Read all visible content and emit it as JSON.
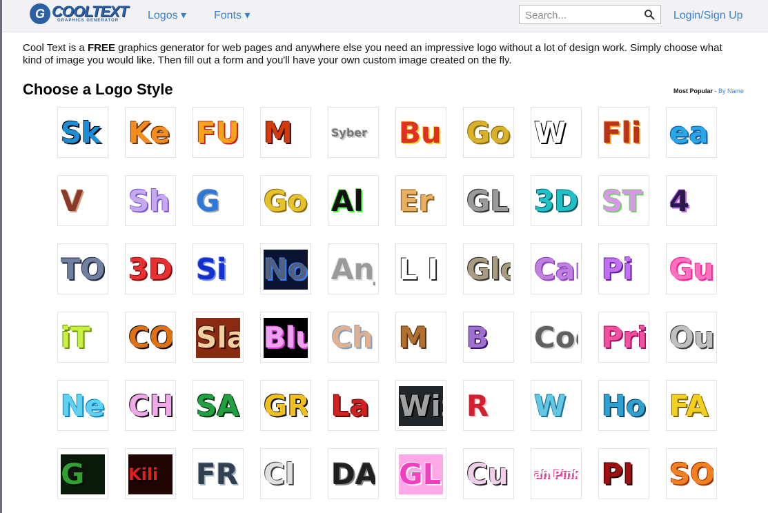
{
  "header": {
    "logo_main": "COOLTEXT",
    "logo_sub": "GRAPHICS GENERATOR",
    "logo_mark": "G",
    "nav": [
      {
        "label": "Logos ▾"
      },
      {
        "label": "Fonts ▾"
      }
    ],
    "search_placeholder": "Search...",
    "login_label": "Login/Sign Up"
  },
  "intro": {
    "part1": "Cool Text is a ",
    "bold": "FREE",
    "part2": " graphics generator for web pages and anywhere else you need an impressive logo without a lot of design work.  Simply choose what kind of image you would like. Then fill out a form and you'll have your own custom image created on the fly."
  },
  "section_title": "Choose a Logo Style",
  "sort": {
    "active": "Most Popular",
    "separator": " - ",
    "other": "By Name"
  },
  "colors": {
    "accent": "#3b7fd0",
    "header_bg": "#f2f2f4"
  },
  "logos": [
    {
      "text": "Sk",
      "color": "#1a8fd6",
      "bg": "#ffffff",
      "shadow": "#000000"
    },
    {
      "text": "Ke",
      "color": "#f28c1c",
      "bg": "#ffffff",
      "shadow": "#6b2c00"
    },
    {
      "text": "FU",
      "color": "#f5a31a",
      "bg": "#ffffff",
      "shadow": "#c3201c"
    },
    {
      "text": "M",
      "color": "#d23a10",
      "bg": "#ffffff",
      "shadow": "#3a0a00"
    },
    {
      "text": "Syber",
      "color": "#777777",
      "bg": "#ffffff",
      "shadow": "#cccccc"
    },
    {
      "text": "Bu",
      "color": "#e03020",
      "bg": "#ffffff",
      "shadow": "#f0d040"
    },
    {
      "text": "Go",
      "color": "#d9b22a",
      "bg": "#ffffff",
      "shadow": "#8a6a10"
    },
    {
      "text": "W",
      "color": "#ffffff",
      "bg": "#ffffff",
      "shadow": "#000000"
    },
    {
      "text": "Fli",
      "color": "#b8321c",
      "bg": "#ffffff",
      "shadow": "#f0a030"
    },
    {
      "text": "ea",
      "color": "#2aa6e8",
      "bg": "#ffffff",
      "shadow": "#0e5c9c"
    },
    {
      "text": "V",
      "color": "#8a3a2a",
      "bg": "#ffffff",
      "shadow": "#d0a080"
    },
    {
      "text": "Sh",
      "color": "#c6a8f0",
      "bg": "#ffffff",
      "shadow": "#7a5ad0"
    },
    {
      "text": "G",
      "color": "#2a78d8",
      "bg": "#ffffff",
      "shadow": "#9aa0a8"
    },
    {
      "text": "Go",
      "color": "#e6c22a",
      "bg": "#ffffff",
      "shadow": "#8a6a10"
    },
    {
      "text": "Al",
      "color": "#111111",
      "bg": "#ffffff",
      "shadow": "#3cf03c"
    },
    {
      "text": "Er",
      "color": "#e8b060",
      "bg": "#ffffff",
      "shadow": "#8a5a20"
    },
    {
      "text": "GL",
      "color": "#9a9a9a",
      "bg": "#ffffff",
      "shadow": "#333333"
    },
    {
      "text": "3D",
      "color": "#20c0c8",
      "bg": "#ffffff",
      "shadow": "#0a5a60"
    },
    {
      "text": "ST",
      "color": "#d898e8",
      "bg": "#ffffff",
      "shadow": "#70d060"
    },
    {
      "text": "4",
      "color": "#2a1a4a",
      "bg": "#ffffff",
      "shadow": "#b060e0"
    },
    {
      "text": "TO",
      "color": "#7080a0",
      "bg": "#ffffff",
      "shadow": "#202840"
    },
    {
      "text": "3D",
      "color": "#e83030",
      "bg": "#ffffff",
      "shadow": "#801010"
    },
    {
      "text": "Si",
      "color": "#1030d0",
      "bg": "#ffffff",
      "shadow": "#8090f0"
    },
    {
      "text": "No",
      "color": "#506080",
      "bg": "#0a1430",
      "shadow": "#3a80ff"
    },
    {
      "text": "Anj",
      "color": "#9a9a9a",
      "bg": "#ffffff",
      "shadow": "#dddddd"
    },
    {
      "text": "L I",
      "color": "#ffffff",
      "bg": "#ffffff",
      "shadow": "#222222"
    },
    {
      "text": "Glo",
      "color": "#a89c80",
      "bg": "#ffffff",
      "shadow": "#333333"
    },
    {
      "text": "Can",
      "color": "#c080e0",
      "bg": "#ffffff",
      "shadow": "#9040c0"
    },
    {
      "text": "Pi",
      "color": "#c070f0",
      "bg": "#ffffff",
      "shadow": "#6020a0"
    },
    {
      "text": "Gu",
      "color": "#ff70c0",
      "bg": "#ffffff",
      "shadow": "#ff2090"
    },
    {
      "text": "iT",
      "color": "#c8f040",
      "bg": "#ffffff",
      "shadow": "#6a9010"
    },
    {
      "text": "CO",
      "color": "#e07010",
      "bg": "#ffffff",
      "shadow": "#111111"
    },
    {
      "text": "Sla",
      "color": "#f0d0a0",
      "bg": "#8a2a10",
      "shadow": "#3a0a00"
    },
    {
      "text": "Blu",
      "color": "#f0a0f0",
      "bg": "#000000",
      "shadow": "#d040d0"
    },
    {
      "text": "Ch",
      "color": "#e0b090",
      "bg": "#ffffff",
      "shadow": "#80a0c0"
    },
    {
      "text": "M",
      "color": "#b07030",
      "bg": "#ffffff",
      "shadow": "#5a3010"
    },
    {
      "text": "B",
      "color": "#a070d0",
      "bg": "#ffffff",
      "shadow": "#3a1060"
    },
    {
      "text": "Coo",
      "color": "#606060",
      "bg": "#ffffff",
      "shadow": "#d0d0d0"
    },
    {
      "text": "Pri",
      "color": "#f050a0",
      "bg": "#ffffff",
      "shadow": "#a01060"
    },
    {
      "text": "Ou",
      "color": "#c0c0c0",
      "bg": "#ffffff",
      "shadow": "#404040"
    },
    {
      "text": "Ne",
      "color": "#60d0f0",
      "bg": "#ffffff",
      "shadow": "#0a80c0"
    },
    {
      "text": "CH",
      "color": "#f0a8e8",
      "bg": "#ffffff",
      "shadow": "#111111"
    },
    {
      "text": "SA",
      "color": "#20a040",
      "bg": "#ffffff",
      "shadow": "#0a3010"
    },
    {
      "text": "GRA",
      "color": "#f0c020",
      "bg": "#ffffff",
      "shadow": "#111111"
    },
    {
      "text": "La",
      "color": "#d02020",
      "bg": "#ffffff",
      "shadow": "#600a0a"
    },
    {
      "text": "Wiz",
      "color": "#a0a0a0",
      "bg": "#20262a",
      "shadow": "#000000"
    },
    {
      "text": "R",
      "color": "#d02030",
      "bg": "#ffffff",
      "shadow": "#f0c0c8"
    },
    {
      "text": "W",
      "color": "#60c8e0",
      "bg": "#ffffff",
      "shadow": "#2070a0"
    },
    {
      "text": "Hor",
      "color": "#30a0d0",
      "bg": "#ffffff",
      "shadow": "#0a4060"
    },
    {
      "text": "FA",
      "color": "#f0d020",
      "bg": "#ffffff",
      "shadow": "#806000"
    },
    {
      "text": "G",
      "color": "#30a030",
      "bg": "#0a1a0a",
      "shadow": "#000000"
    },
    {
      "text": "Kili",
      "color": "#e02020",
      "bg": "#200404",
      "shadow": "#000000"
    },
    {
      "text": "FR",
      "color": "#304050",
      "bg": "#ffffff",
      "shadow": "#a0b0c0"
    },
    {
      "text": "Cl",
      "color": "#e0e0e0",
      "bg": "#ffffff",
      "shadow": "#404040"
    },
    {
      "text": "DA",
      "color": "#202020",
      "bg": "#ffffff",
      "shadow": "#808080"
    },
    {
      "text": "GL",
      "color": "#f040c0",
      "bg": "#ffa8e8",
      "shadow": "#ffffff"
    },
    {
      "text": "Cu",
      "color": "#f0d0e8",
      "bg": "#ffffff",
      "shadow": "#202020"
    },
    {
      "text": "ah Pink",
      "color": "#ffffff",
      "bg": "#ffffff",
      "shadow": "#e04090"
    },
    {
      "text": "PI",
      "color": "#a01010",
      "bg": "#ffffff",
      "shadow": "#200000"
    },
    {
      "text": "SO",
      "color": "#f08020",
      "bg": "#ffffff",
      "shadow": "#a03000"
    }
  ]
}
